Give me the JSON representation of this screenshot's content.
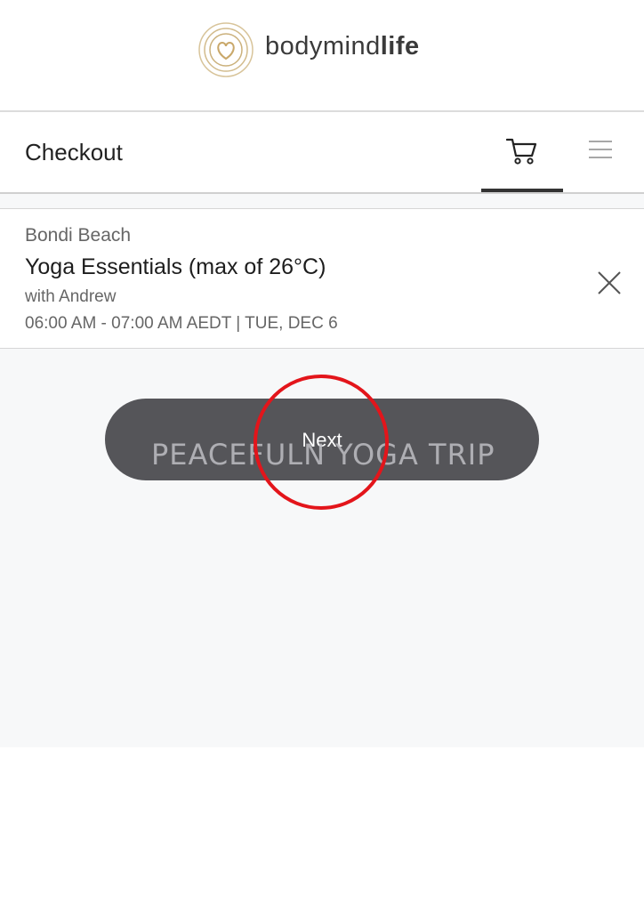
{
  "brand": {
    "name_regular": "bodymind",
    "name_bold": "life",
    "accent_color": "#c9a86a"
  },
  "navbar": {
    "title": "Checkout",
    "cart_icon": "cart-icon",
    "menu_icon": "hamburger-menu-icon"
  },
  "cart_item": {
    "location": "Bondi Beach",
    "class_name": "Yoga Essentials (max of 26°C)",
    "instructor": "with Andrew",
    "schedule": "06:00 AM - 07:00 AM AEDT | TUE, DEC 6",
    "remove_icon": "close-icon"
  },
  "actions": {
    "next_label": "Next"
  },
  "overlay": {
    "watermark_text": "PEACEFULN YOGA TRIP",
    "highlight_color": "#e3151b"
  }
}
